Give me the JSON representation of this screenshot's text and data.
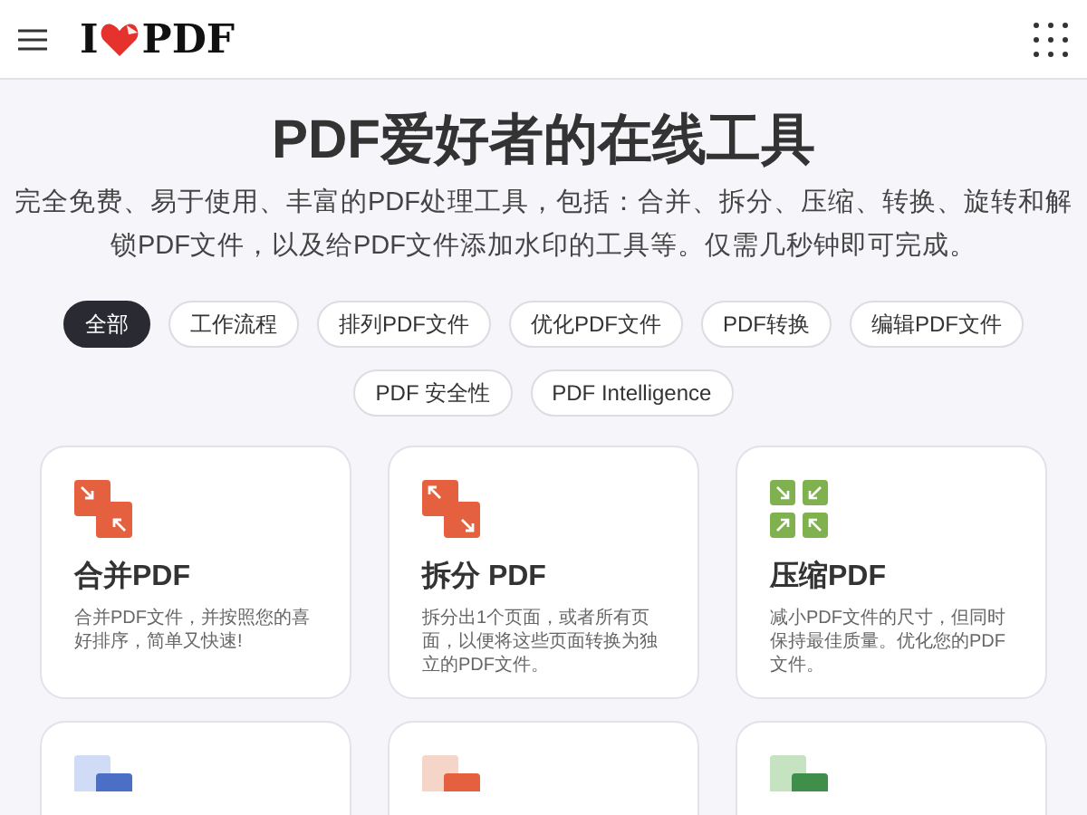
{
  "header": {
    "logo_left": "I",
    "logo_right": "PDF"
  },
  "hero": {
    "title": "PDF爱好者的在线工具",
    "subtitle": "完全免费、易于使用、丰富的PDF处理工具，包括：合并、拆分、压缩、转换、旋转和解锁PDF文件，以及给PDF文件添加水印的工具等。仅需几秒钟即可完成。"
  },
  "filters": [
    {
      "label": "全部",
      "selected": true
    },
    {
      "label": "工作流程",
      "selected": false
    },
    {
      "label": "排列PDF文件",
      "selected": false
    },
    {
      "label": "优化PDF文件",
      "selected": false
    },
    {
      "label": "PDF转换",
      "selected": false
    },
    {
      "label": "编辑PDF文件",
      "selected": false
    },
    {
      "label": "PDF 安全性",
      "selected": false
    },
    {
      "label": "PDF Intelligence",
      "selected": false
    }
  ],
  "tools": [
    {
      "kind": "merge",
      "title": "合并PDF",
      "description": "合并PDF文件，并按照您的喜好排序，简单又快速!"
    },
    {
      "kind": "split",
      "title": "拆分 PDF",
      "description": "拆分出1个页面，或者所有页面，以便将这些页面转换为独立的PDF文件。"
    },
    {
      "kind": "compress",
      "title": "压缩PDF",
      "description": "减小PDF文件的尺寸，但同时保持最佳质量。优化您的PDF文件。"
    },
    {
      "kind": "blue"
    },
    {
      "kind": "orange"
    },
    {
      "kind": "green"
    }
  ]
}
